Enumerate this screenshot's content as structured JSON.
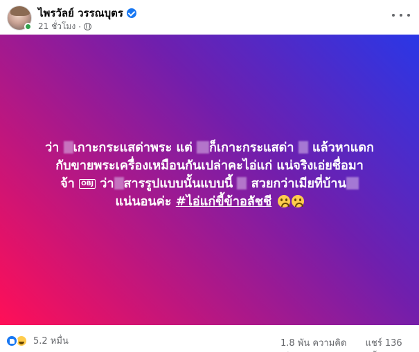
{
  "author": {
    "name": "ไพรวัลย์ วรรณบุตร",
    "time": "21 ชั่วโมง",
    "icons": [
      "verified-icon",
      "globe-icon"
    ]
  },
  "post": {
    "lines": [
      [
        "ว่า",
        "เกาะกระแสด่าพระ แต่",
        "ก็เกาะกระแสด่า",
        "แล้วหาแดก"
      ],
      [
        "กับขายพระเครื่องเหมือนกันเปล่าคะไอ่แก่ แน่จริงเอ่ยชื่อมา"
      ],
      [
        "จ้า",
        "OBJ",
        "ว่า",
        "สารรูปแบบนั้นแบบนี้",
        "สวยกว่าเมียที่บ้าน"
      ],
      [
        "แน่นอนค่ะ",
        "#ไอ่แก่ขี้ข้าอลัชชี"
      ]
    ],
    "background": {
      "start": "#ff0f57",
      "mid": "#6f1fae",
      "end": "#2a37e6"
    }
  },
  "footer": {
    "reactions": "5.2 หมื่น",
    "comments": "1.8 พัน ความคิดเห็น",
    "shares": "แชร์ 136 ครั้ง"
  }
}
